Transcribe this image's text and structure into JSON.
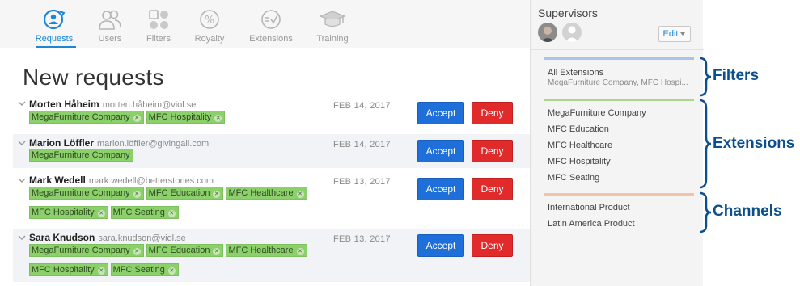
{
  "nav": {
    "items": [
      {
        "label": "Requests",
        "icon": "requests-icon",
        "active": true
      },
      {
        "label": "Users",
        "icon": "users-icon"
      },
      {
        "label": "Filters",
        "icon": "filters-icon"
      },
      {
        "label": "Royalty",
        "icon": "royalty-icon"
      },
      {
        "label": "Extensions",
        "icon": "extensions-icon"
      },
      {
        "label": "Training",
        "icon": "training-icon"
      }
    ]
  },
  "main": {
    "title": "New requests",
    "accept_label": "Accept",
    "deny_label": "Deny",
    "requests": [
      {
        "name": "Morten Håheim",
        "email": "morten.håheim@viol.se",
        "date": "FEB 14, 2017",
        "tag_lines": [
          [
            "MegaFurniture Company",
            "MFC Hospitality"
          ]
        ]
      },
      {
        "name": "Marion Löffler",
        "email": "marion.löffler@givingall.com",
        "date": "FEB 14, 2017",
        "tag_lines": [
          [
            "MegaFurniture Company"
          ]
        ]
      },
      {
        "name": "Mark Wedell",
        "email": "mark.wedell@betterstories.com",
        "date": "FEB 13, 2017",
        "tag_lines": [
          [
            "MegaFurniture Company",
            "MFC Education",
            "MFC Healthcare"
          ],
          [
            "MFC Hospitality",
            "MFC Seating"
          ]
        ]
      },
      {
        "name": "Sara Knudson",
        "email": "sara.knudson@viol.se",
        "date": "FEB 13, 2017",
        "tag_lines": [
          [
            "MegaFurniture Company",
            "MFC Education",
            "MFC Healthcare"
          ],
          [
            "MFC Hospitality",
            "MFC Seating"
          ]
        ]
      }
    ]
  },
  "side": {
    "supervisors_title": "Supervisors",
    "edit_label": "Edit",
    "filters": {
      "title": "All Extensions",
      "subtitle": "MegaFurniture Company, MFC Hospi...",
      "color": "#a9c4e4"
    },
    "extensions": {
      "items": [
        "MegaFurniture Company",
        "MFC Education",
        "MFC Healthcare",
        "MFC Hospitality",
        "MFC Seating"
      ],
      "color": "#a9d68a"
    },
    "channels": {
      "items": [
        "International Product",
        "Latin America Product"
      ],
      "color": "#f1c3a8"
    }
  },
  "annotations": {
    "filters": "Filters",
    "extensions": "Extensions",
    "channels": "Channels",
    "color": "#0b4f8f"
  },
  "colors": {
    "accent": "#1e86d6",
    "accept": "#1e6fd9",
    "deny": "#e12b2b",
    "tag": "#8bd06a"
  }
}
